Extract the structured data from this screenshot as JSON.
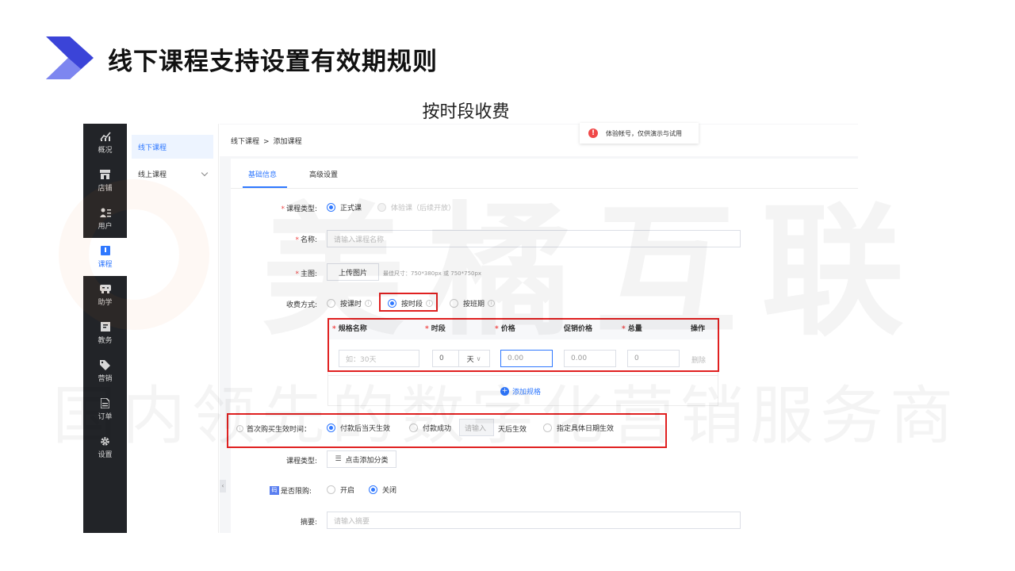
{
  "slide": {
    "title": "线下课程支持设置有效期规则",
    "subtitle": "按时段收费",
    "accent": "#3b44d8"
  },
  "watermark": {
    "big": "美橘互联",
    "line": "国内领先的数字化营销服务商"
  },
  "sidebar": {
    "items": [
      {
        "label": "概况",
        "icon": "chart-icon"
      },
      {
        "label": "店铺",
        "icon": "store-icon"
      },
      {
        "label": "用户",
        "icon": "users-icon"
      },
      {
        "label": "课程",
        "icon": "book-icon",
        "active": true
      },
      {
        "label": "助学",
        "icon": "gamepad-icon"
      },
      {
        "label": "教务",
        "icon": "notebook-icon"
      },
      {
        "label": "营销",
        "icon": "tag-icon"
      },
      {
        "label": "订单",
        "icon": "document-icon"
      },
      {
        "label": "设置",
        "icon": "gear-icon"
      }
    ]
  },
  "subnav": {
    "items": [
      {
        "label": "线下课程"
      },
      {
        "label": "线上课程"
      }
    ]
  },
  "breadcrumb": {
    "root": "线下课程",
    "sep": ">",
    "current": "添加课程"
  },
  "notice": {
    "text": "体验帐号，仅供演示与试用"
  },
  "tabs": {
    "basic": "基础信息",
    "advanced": "高级设置"
  },
  "form": {
    "course_type": {
      "label": "课程类型:",
      "options": [
        "正式课",
        "体验课（后续开放）"
      ]
    },
    "name": {
      "label": "名称:",
      "placeholder": "请输入课程名称"
    },
    "main_image": {
      "label": "主图:",
      "button": "上传图片",
      "hint": "最佳尺寸：750*380px 或 750*750px"
    },
    "charge": {
      "label": "收费方式:",
      "options": [
        "按课时",
        "按时段",
        "按班期"
      ]
    },
    "spec_table": {
      "headers": [
        "规格名称",
        "时段",
        "价格",
        "促销价格",
        "总量",
        "操作"
      ],
      "row": {
        "name_placeholder": "如：30天",
        "period": "0",
        "unit": "天",
        "price": "0.00",
        "promo": "0.00",
        "total": "0",
        "action": "删除"
      },
      "add": "添加规格"
    },
    "effective": {
      "label": "首次购买生效时间：",
      "options": [
        "付款后当天生效",
        "付款成功",
        "天后生效",
        "指定具体日期生效"
      ],
      "days_placeholder": "请输入"
    },
    "category": {
      "label": "课程类型:",
      "button": "点击添加分类"
    },
    "limit": {
      "badge": "码",
      "label": "是否限购:",
      "options": [
        "开启",
        "关闭"
      ]
    },
    "summary": {
      "label": "摘要:",
      "placeholder": "请输入摘要"
    }
  }
}
